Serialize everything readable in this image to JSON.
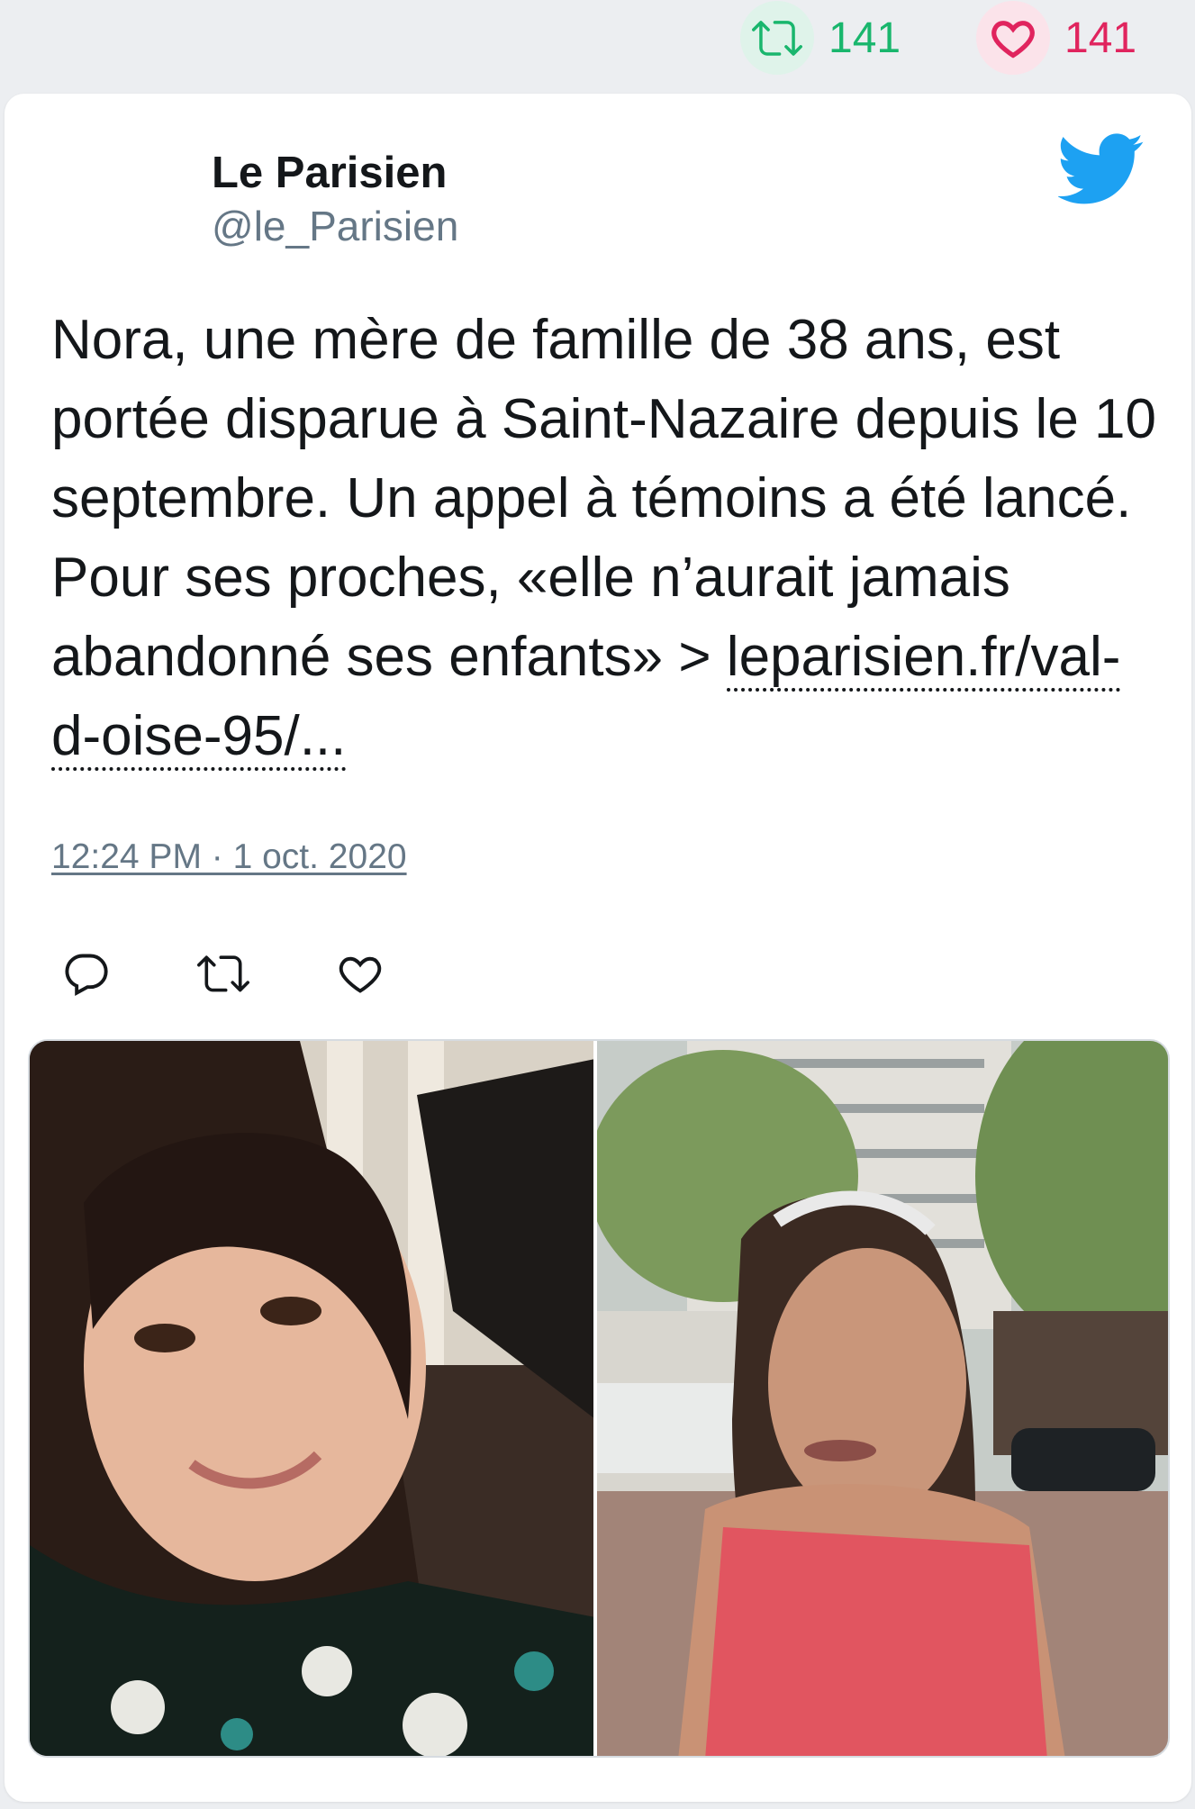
{
  "top_stats": {
    "retweets": "141",
    "likes": "141",
    "retweet_icon": "retweet-icon",
    "like_icon": "heart-icon"
  },
  "tweet": {
    "author_name": "Le Parisien",
    "author_handle": "@le_Parisien",
    "text": "Nora, une mère de famille de 38 ans, est portée disparue à Saint-Nazaire depuis le 10 septembre. Un appel à témoins a été lancé. Pour ses proches, «elle n’aurait jamais abandonné ses enfants» > ",
    "link_text": "leparisien.fr/val-d-oise-95/...",
    "timestamp": "12:24 PM · 1 oct. 2020"
  },
  "actions": [
    "reply-icon",
    "retweet-icon",
    "like-icon"
  ],
  "media": {
    "images": [
      "photo-selfie-woman-indoor",
      "photo-woman-street"
    ]
  },
  "colors": {
    "retweet": "#19b66d",
    "like": "#e0245e",
    "twitter_blue": "#1da1f2",
    "muted": "#657786",
    "text": "#14171a"
  }
}
